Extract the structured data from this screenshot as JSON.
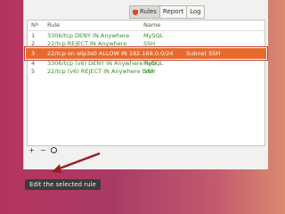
{
  "toolbar": {
    "rules_label": "Rules",
    "report_label": "Report",
    "log_label": "Log"
  },
  "table": {
    "headers": {
      "num": "Nº",
      "rule": "Rule",
      "name": "Name"
    },
    "rows": [
      {
        "num": "1",
        "rule": "3306/tcp DENY IN Anywhere",
        "name": "MySQL",
        "color": "#3e8a2e"
      },
      {
        "num": "2",
        "rule": "22/tcp REJECT IN Anywhere",
        "name": "SSH",
        "color": "#3e8a2e"
      },
      {
        "num": "3",
        "rule": "22/tcp on wlp3s0 ALLOW IN 192.168.0.0/24",
        "name": "Subnet SSH",
        "color": "#ffffff"
      },
      {
        "num": "4",
        "rule": "3306/tcp (v6) DENY IN Anywhere (v6)",
        "name": "MySQL",
        "color": "#3e8a2e"
      },
      {
        "num": "5",
        "rule": "22/tcp (v6) REJECT IN Anywhere (v6)",
        "name": "SSH",
        "color": "#3e8a2e"
      }
    ]
  },
  "bottom": {
    "add": "+",
    "remove": "−"
  },
  "tooltip": {
    "text": "Edit the selected rule"
  },
  "colors": {
    "accent": "#e8692c",
    "text_green": "#3e8a2e",
    "arrow": "#9b1c1c"
  }
}
